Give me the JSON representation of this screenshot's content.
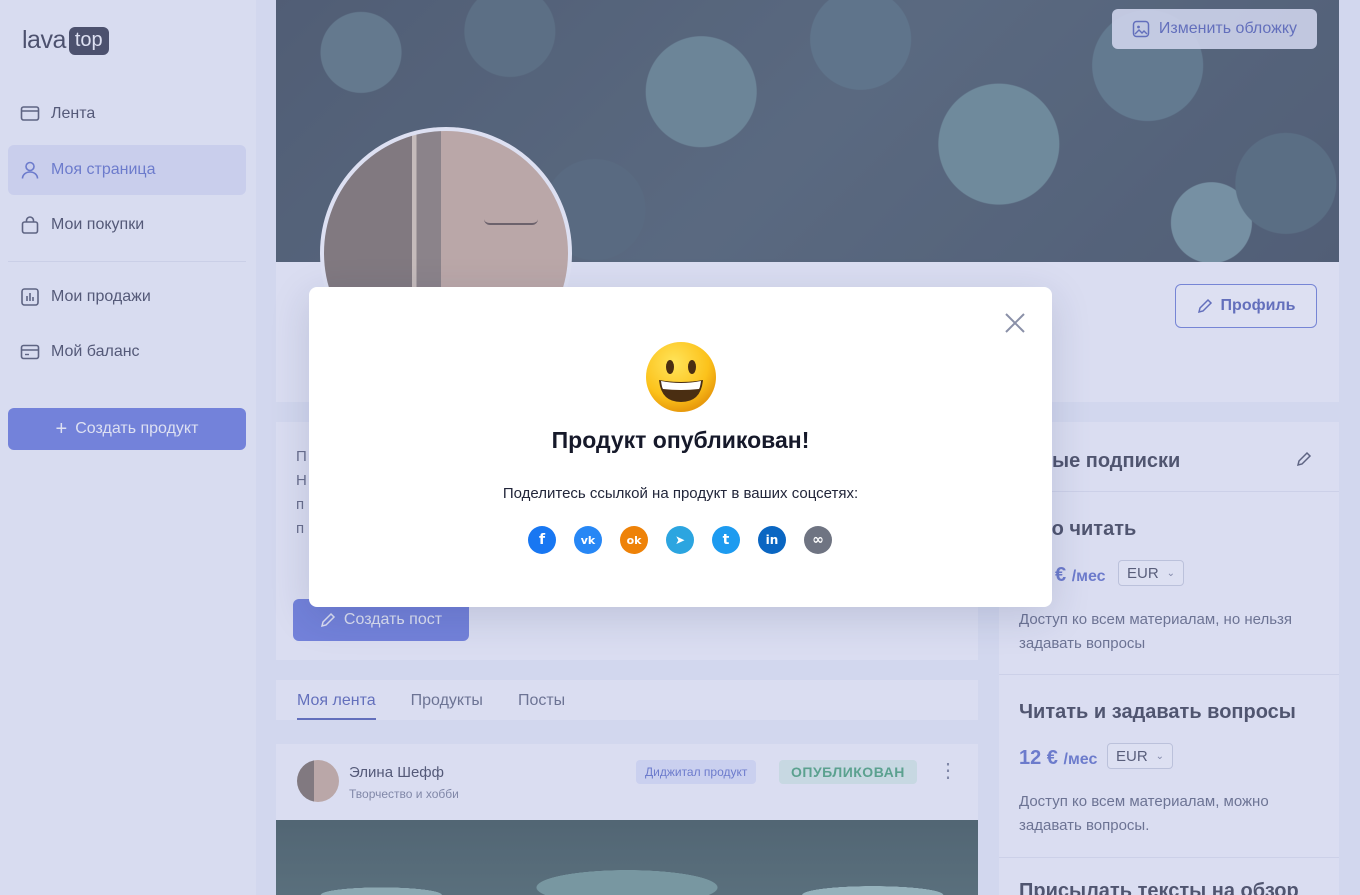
{
  "logo": {
    "text": "lava",
    "badge": "top"
  },
  "sidebar": {
    "items": [
      {
        "label": "Лента",
        "icon": "feed-icon"
      },
      {
        "label": "Моя страница",
        "icon": "user-icon",
        "active": true
      },
      {
        "label": "Мои покупки",
        "icon": "bag-icon"
      },
      {
        "label": "Мои продажи",
        "icon": "sales-chart-icon"
      },
      {
        "label": "Мой баланс",
        "icon": "wallet-icon"
      }
    ],
    "create_button": "Создать продукт"
  },
  "cover": {
    "change_button": "Изменить обложку"
  },
  "profile": {
    "edit_button": "Профиль"
  },
  "about": {
    "lines": [
      "П",
      "Н",
      "п",
      "п"
    ],
    "create_post_button": "Создать пост"
  },
  "tabs": [
    {
      "label": "Моя лента",
      "active": true
    },
    {
      "label": "Продукты"
    },
    {
      "label": "Посты"
    }
  ],
  "feed_post": {
    "author": "Элина Шефф",
    "category": "Творчество и хобби",
    "type_tag": "Диджитал продукт",
    "status": "ОПУБЛИКОВАН",
    "more": "⋮"
  },
  "subscriptions": {
    "title": "атные подписки",
    "plans": [
      {
        "name": "осто читать",
        "price": "€",
        "period": "/мес",
        "currency": "EUR",
        "description": "Доступ ко всем материалам, но нельзя задавать вопросы"
      },
      {
        "name": "Читать и задавать вопросы",
        "price": "12 €",
        "period": "/мес",
        "currency": "EUR",
        "description": "Доступ ко всем материалам, можно задавать вопросы."
      },
      {
        "name": "Присылать тексты на обзор"
      }
    ]
  },
  "modal": {
    "title": "Продукт опубликован!",
    "text": "Поделитесь ссылкой на продукт в ваших соцсетях:",
    "share": [
      {
        "name": "facebook",
        "glyph": "f",
        "color": "#1877f2"
      },
      {
        "name": "vk",
        "glyph": "vk",
        "color": "#2787f5"
      },
      {
        "name": "odnoklassniki",
        "glyph": "ok",
        "color": "#ee8208"
      },
      {
        "name": "telegram",
        "glyph": "➤",
        "color": "#2ca5e0"
      },
      {
        "name": "twitter",
        "glyph": "t",
        "color": "#1d9bf0"
      },
      {
        "name": "linkedin",
        "glyph": "in",
        "color": "#0a66c2"
      },
      {
        "name": "copy-link",
        "glyph": "∞",
        "color": "#6f7482"
      }
    ]
  },
  "colors": {
    "accent": "#5468d8",
    "published": "#2e9a60"
  }
}
